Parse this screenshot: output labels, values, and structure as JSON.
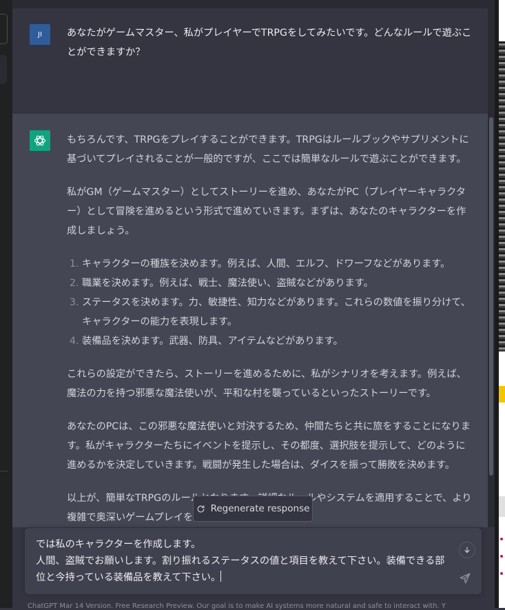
{
  "user_message": {
    "avatar_initials": "JI",
    "text": "あなたがゲームマスター、私がプレイヤーでTRPGをしてみたいです。どんなルールで遊ぶことができますか？"
  },
  "assistant_message": {
    "para1": "もちろんです、TRPGをプレイすることができます。TRPGはルールブックやサプリメントに基づいてプレイされることが一般的ですが、ここでは簡単なルールで遊ぶことができます。",
    "para2": "私がGM（ゲームマスター）としてストーリーを進め、あなたがPC（プレイヤーキャラクター）として冒険を進めるという形式で進めていきます。まずは、あなたのキャラクターを作成しましょう。",
    "list": [
      "キャラクターの種族を決めます。例えば、人間、エルフ、ドワーフなどがあります。",
      "職業を決めます。例えば、戦士、魔法使い、盗賊などがあります。",
      "ステータスを決めます。力、敏捷性、知力などがあります。これらの数値を振り分けて、キャラクターの能力を表現します。",
      "装備品を決めます。武器、防具、アイテムなどがあります。"
    ],
    "para3": "これらの設定ができたら、ストーリーを進めるために、私がシナリオを考えます。例えば、魔法の力を持つ邪悪な魔法使いが、平和な村を襲っているといったストーリーです。",
    "para4": "あなたのPCは、この邪悪な魔法使いと対決するため、仲間たちと共に旅をすることになります。私がキャラクターたちにイベントを提示し、その都度、選択肢を提示して、どのように進めるかを決定していきます。戦闘が発生した場合は、ダイスを振って勝敗を決めます。",
    "para5": "以上が、簡単なTRPGのルールとなります。詳細なルールやシステムを適用することで、より複雑で奥深いゲームプレイを楽しむことができます。"
  },
  "regenerate": {
    "icon": "refresh-icon",
    "label": "Regenerate response"
  },
  "composer": {
    "text": "では私のキャラクターを作成します。\n人間、盗賊でお願いします。割り振れるステータスの値と項目を教えて下さい。装備できる部位と今持っている装備品を教えて下さい。",
    "send_icon": "send-icon",
    "scroll_icon": "arrow-down-icon"
  },
  "footer": {
    "text": "ChatGPT Mar 14 Version. Free Research Preview. Our goal is to make AI systems more natural and safe to interact with. Y"
  },
  "colors": {
    "background": "#343541",
    "assistant_background": "#444654",
    "bot_avatar": "#10a37f",
    "user_avatar": "#2f5c9a"
  }
}
